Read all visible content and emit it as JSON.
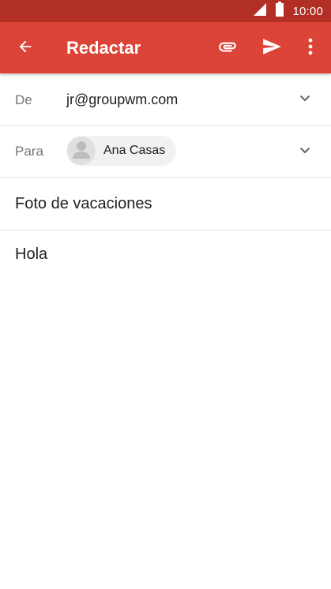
{
  "status_bar": {
    "time": "10:00",
    "icons": [
      "signal-icon",
      "battery-icon"
    ]
  },
  "app_bar": {
    "title": "Redactar",
    "icons": [
      "arrow-back-icon",
      "paperclip-icon",
      "send-icon",
      "more-vert-icon"
    ]
  },
  "compose": {
    "from": {
      "label": "De",
      "value": "jr@groupwm.com"
    },
    "to": {
      "label": "Para",
      "recipients": [
        {
          "name": "Ana Casas"
        }
      ]
    },
    "subject": "Foto de vacaciones",
    "body": "Hola"
  },
  "colors": {
    "status_bar": "#b22f25",
    "app_bar": "#db4437",
    "chip_background": "#f1f1f1",
    "divider": "#e3e3e3",
    "label_text": "#757575",
    "primary_text": "#212121"
  }
}
